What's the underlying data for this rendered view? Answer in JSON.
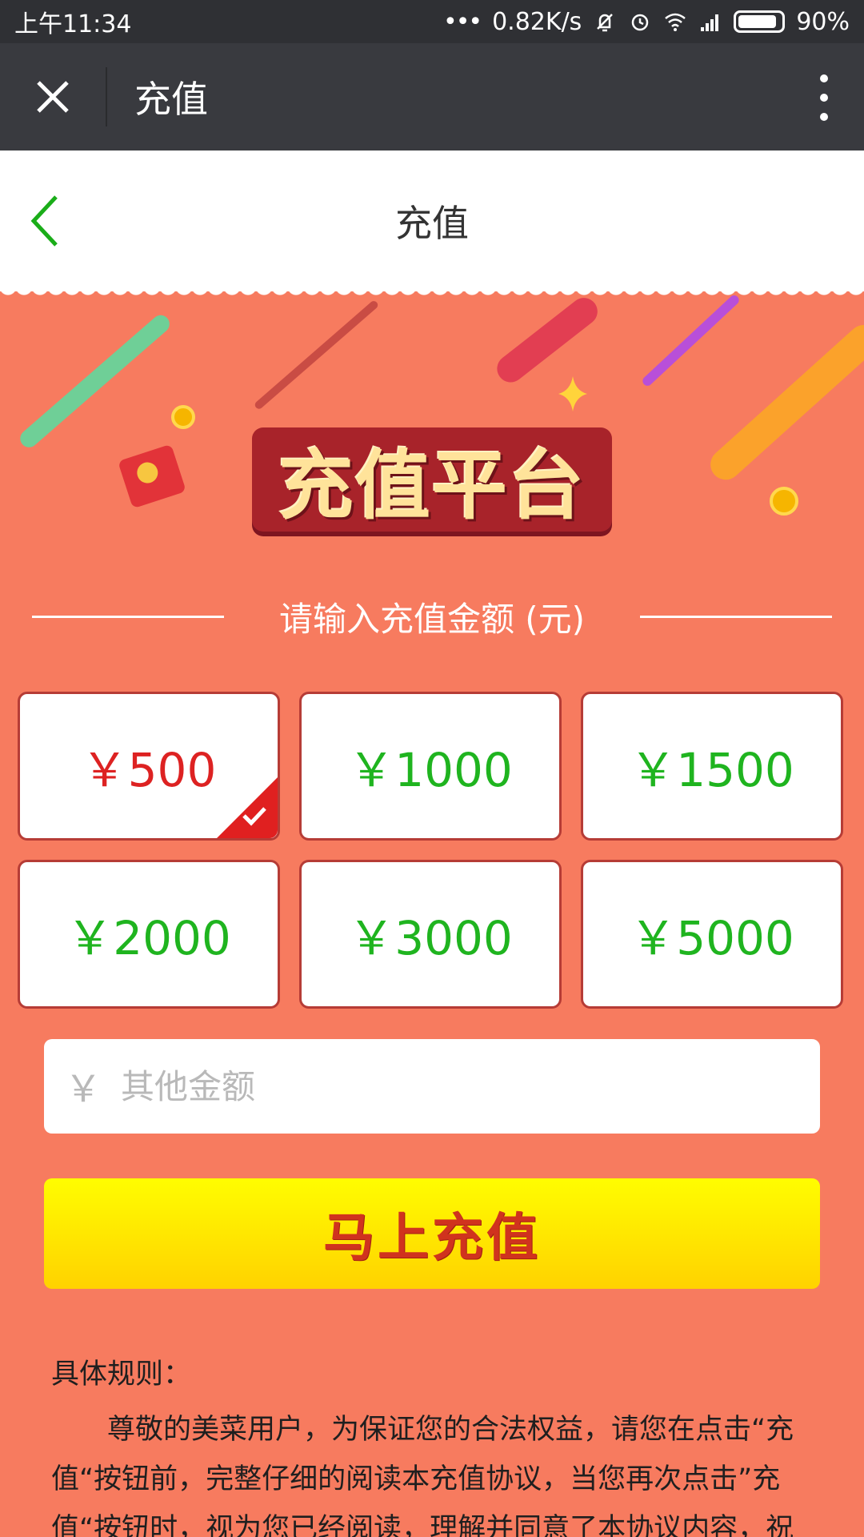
{
  "status_bar": {
    "time": "上午11:34",
    "network_speed": "0.82K/s",
    "battery": "90%",
    "battery_level": 0.9
  },
  "app_bar": {
    "title": "充值",
    "close_icon": "close-icon",
    "more_icon": "more-vertical-icon"
  },
  "page_header": {
    "title": "充值",
    "back_icon": "chevron-left-icon"
  },
  "banner": {
    "title": "充值平台"
  },
  "section": {
    "label": "请输入充值金额 (元)"
  },
  "amounts": [
    {
      "label": "￥500",
      "selected": true
    },
    {
      "label": "￥1000",
      "selected": false
    },
    {
      "label": "￥1500",
      "selected": false
    },
    {
      "label": "￥2000",
      "selected": false
    },
    {
      "label": "￥3000",
      "selected": false
    },
    {
      "label": "￥5000",
      "selected": false
    }
  ],
  "other_amount": {
    "prefix": "￥",
    "placeholder": "其他金额",
    "value": ""
  },
  "recharge_button": {
    "label": "马上充值"
  },
  "rules": {
    "title": "具体规则：",
    "text": "尊敬的美菜用户，为保证您的合法权益，请您在点击“充值“按钮前，完整仔细的阅读本充值协议，当您再次点击”充值“按钮时，视为您已经阅读，理解并同意了本协议内容，祝"
  },
  "colors": {
    "page_background": "#f77b5f",
    "selected_amount": "#dd2222",
    "amount_text": "#1fb41f",
    "button_yellow": "#ffe000",
    "button_text": "#d0331e"
  }
}
